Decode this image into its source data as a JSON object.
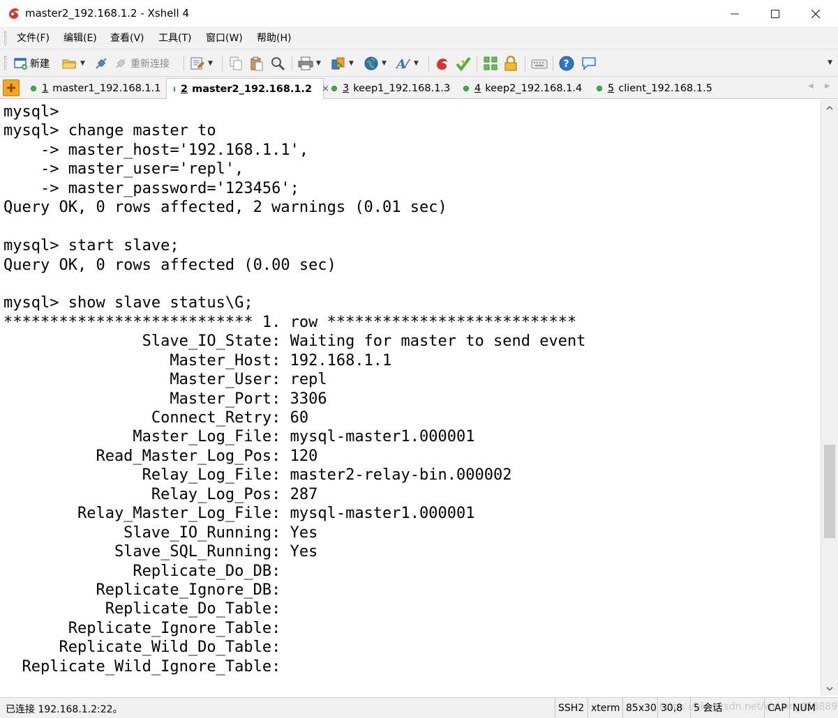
{
  "window": {
    "title": "master2_192.168.1.2 - Xshell 4",
    "minimize": "—",
    "maximize": "☐",
    "close": "✕"
  },
  "menu": [
    {
      "label": "文件(F)"
    },
    {
      "label": "编辑(E)"
    },
    {
      "label": "查看(V)"
    },
    {
      "label": "工具(T)"
    },
    {
      "label": "窗口(W)"
    },
    {
      "label": "帮助(H)"
    }
  ],
  "toolbar": {
    "new_label": "新建",
    "reconnect_label": "重新连接"
  },
  "tabs": [
    {
      "num": "1",
      "label": "master1_192.168.1.1"
    },
    {
      "num": "2",
      "label": "master2_192.168.1.2",
      "close": "×"
    },
    {
      "num": "3",
      "label": "keep1_192.168.1.3"
    },
    {
      "num": "4",
      "label": "keep2_192.168.1.4"
    },
    {
      "num": "5",
      "label": "client_192.168.1.5"
    }
  ],
  "terminal": {
    "lines": [
      "mysql>",
      "mysql> change master to",
      "    -> master_host='192.168.1.1',",
      "    -> master_user='repl',",
      "    -> master_password='123456';",
      "Query OK, 0 rows affected, 2 warnings (0.01 sec)",
      "",
      "mysql> start slave;",
      "Query OK, 0 rows affected (0.00 sec)",
      "",
      "mysql> show slave status\\G;",
      "*************************** 1. row ***************************",
      "               Slave_IO_State: Waiting for master to send event",
      "                  Master_Host: 192.168.1.1",
      "                  Master_User: repl",
      "                  Master_Port: 3306",
      "                Connect_Retry: 60",
      "              Master_Log_File: mysql-master1.000001",
      "          Read_Master_Log_Pos: 120",
      "               Relay_Log_File: master2-relay-bin.000002",
      "                Relay_Log_Pos: 287",
      "        Relay_Master_Log_File: mysql-master1.000001",
      "             Slave_IO_Running: Yes",
      "            Slave_SQL_Running: Yes",
      "              Replicate_Do_DB:",
      "          Replicate_Ignore_DB:",
      "           Replicate_Do_Table:",
      "       Replicate_Ignore_Table:",
      "      Replicate_Wild_Do_Table:",
      "  Replicate_Wild_Ignore_Table:"
    ]
  },
  "status": {
    "connection": "已连接 192.168.1.2:22。",
    "protocol": "SSH2",
    "terminal_type": "xterm",
    "size": "85x30",
    "cursor": "30,8",
    "sessions": "5 会话",
    "watermark": "https://blog.csdn.net/weixin_45888986",
    "cap": "CAP",
    "num": "NUM"
  },
  "colors": {
    "tab_dot": "#3cb043",
    "tab_add": "#f4a623",
    "chrome": "#f2f2f2"
  }
}
